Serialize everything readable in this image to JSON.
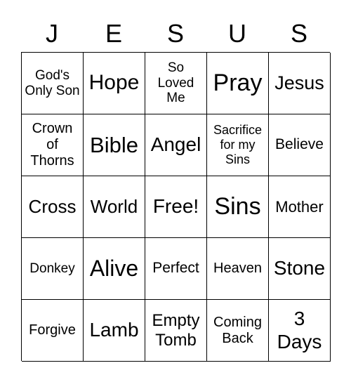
{
  "header": [
    "J",
    "E",
    "S",
    "U",
    "S"
  ],
  "cells": [
    [
      "God's Only Son",
      "Hope",
      "So Loved Me",
      "Pray",
      "Jesus"
    ],
    [
      "Crown of Thorns",
      "Bible",
      "Angel",
      "Sacrifice for my Sins",
      "Believe"
    ],
    [
      "Cross",
      "World",
      "Free!",
      "Sins",
      "Mother"
    ],
    [
      "Donkey",
      "Alive",
      "Perfect",
      "Heaven",
      "Stone"
    ],
    [
      "Forgive",
      "Lamb",
      "Empty Tomb",
      "Coming Back",
      "3 Days"
    ]
  ]
}
